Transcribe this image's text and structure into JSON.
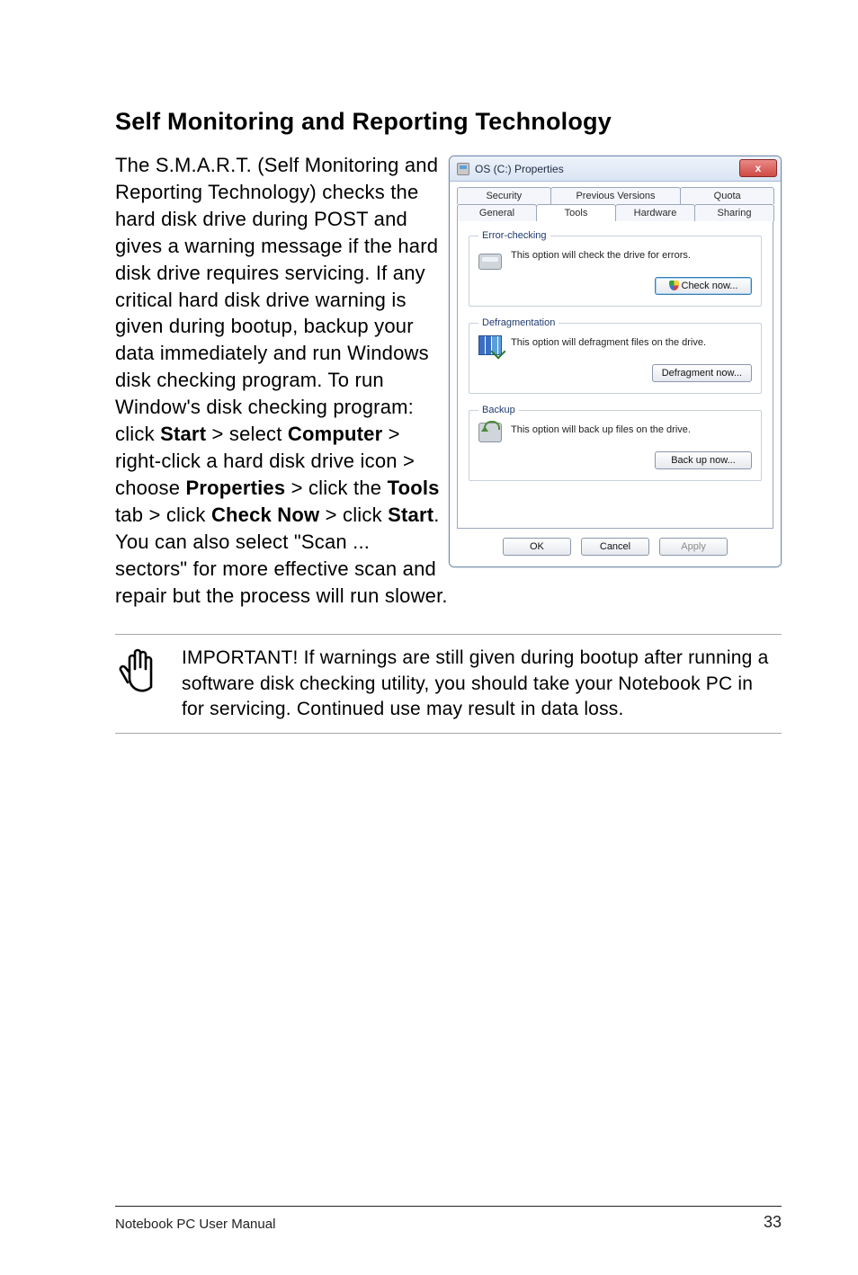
{
  "heading": "Self Monitoring and Reporting Technology",
  "body": {
    "p1a": "The S.M.A.R.T. (Self Monitoring and Reporting Technology) checks the hard disk drive during POST and gives a warning message if the hard disk drive requires servicing. If any critical hard disk drive warning is given during bootup, backup your data immediately and run Windows disk checking program. To run Window's disk checking program: click ",
    "b_start": "Start",
    "p1b": " > select ",
    "b_computer": "Computer",
    "p1c": " > right-click a hard disk drive icon > choose ",
    "b_properties": "Properties",
    "p1d": " > click the ",
    "b_tools": "Tools",
    "p1e": " tab > click ",
    "b_checknow": "Check Now",
    "p1f": " > click ",
    "b_start2": "Start",
    "p1g": ". You can also select \"Scan ... sectors\" for more effective scan and repair but the process will run slower."
  },
  "note": "IMPORTANT! If warnings are still given during bootup after running a software disk checking utility, you should take your Notebook PC in for servicing. Continued use may result in data loss.",
  "dialog": {
    "title": "OS (C:) Properties",
    "close": "x",
    "tabs_top": [
      "Security",
      "Previous Versions",
      "Quota"
    ],
    "tabs_bottom": [
      "General",
      "Tools",
      "Hardware",
      "Sharing"
    ],
    "active_tab": "Tools",
    "groups": {
      "error": {
        "legend": "Error-checking",
        "text": "This option will check the drive for errors.",
        "button": "Check now..."
      },
      "defrag": {
        "legend": "Defragmentation",
        "text": "This option will defragment files on the drive.",
        "button": "Defragment now..."
      },
      "backup": {
        "legend": "Backup",
        "text": "This option will back up files on the drive.",
        "button": "Back up now..."
      }
    },
    "buttons": {
      "ok": "OK",
      "cancel": "Cancel",
      "apply": "Apply"
    }
  },
  "footer": {
    "left": "Notebook PC User Manual",
    "page": "33"
  }
}
